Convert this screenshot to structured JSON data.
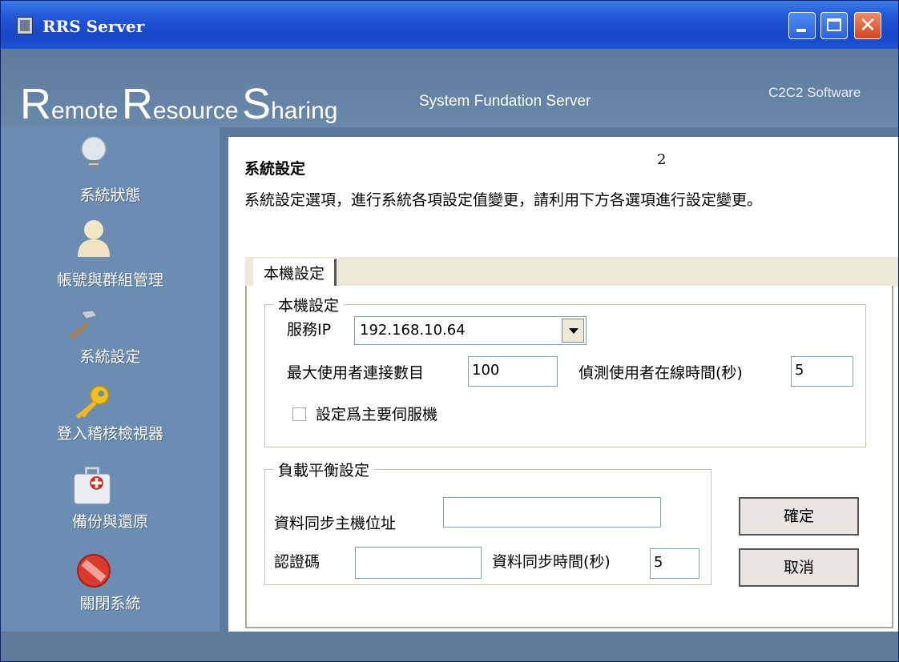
{
  "window": {
    "title": "RRS Server"
  },
  "banner": {
    "brand_R1": "R",
    "brand_rest1": "emote",
    "brand_R2": "R",
    "brand_rest2": "esource",
    "brand_S": "S",
    "brand_rest3": "haring",
    "subtitle": "System Fundation Server",
    "company": "C2C2  Software"
  },
  "sidebar": {
    "items": [
      {
        "label": "系統狀態",
        "icon": "lightbulb-icon"
      },
      {
        "label": "帳號與群組管理",
        "icon": "user-icon"
      },
      {
        "label": "系統設定",
        "icon": "hammer-icon"
      },
      {
        "label": "登入稽核檢視器",
        "icon": "key-icon"
      },
      {
        "label": "備份與還原",
        "icon": "first-aid-kit-icon"
      },
      {
        "label": "關閉系統",
        "icon": "stop-icon"
      }
    ]
  },
  "main": {
    "title": "系統設定",
    "page_number": "2",
    "description": "系統設定選項，進行系統各項設定值變更，請利用下方各選項進行設定變更。",
    "tabs": [
      {
        "label": "本機設定"
      }
    ],
    "local_group": {
      "legend": "本機設定",
      "service_ip_label": "服務IP",
      "service_ip_value": "192.168.10.64",
      "max_users_label": "最大使用者連接數目",
      "max_users_value": "100",
      "detect_online_label": "偵測使用者在線時間(秒)",
      "detect_online_value": "5",
      "primary_server_label": "設定爲主要伺服機",
      "primary_server_checked": false
    },
    "load_balance_group": {
      "legend": "負載平衡設定",
      "sync_host_label": "資料同步主機位址",
      "sync_host_value": "",
      "auth_code_label": "認證碼",
      "auth_code_value": "",
      "sync_time_label": "資料同步時間(秒)",
      "sync_time_value": "5"
    },
    "buttons": {
      "ok_label": "確定",
      "cancel_label": "取消"
    }
  },
  "colors": {
    "titlebar": "#2459d8",
    "sidebar": "#6b8db2",
    "banner": "#5d7b9c",
    "panel": "#ffffff"
  }
}
